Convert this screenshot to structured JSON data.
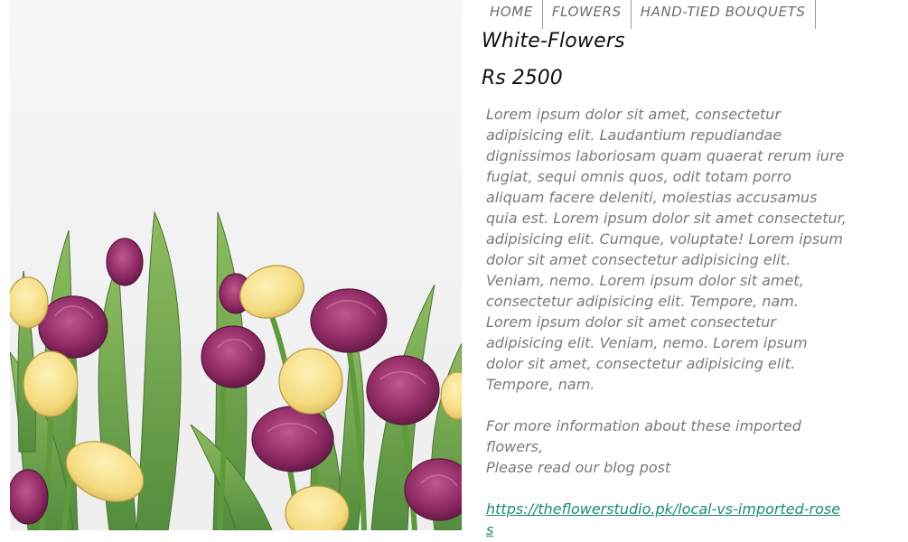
{
  "nav": {
    "items": [
      {
        "label": "HOME"
      },
      {
        "label": "FLOWERS"
      },
      {
        "label": "HAND-TIED BOUQUETS"
      }
    ]
  },
  "product": {
    "title": "White-Flowers",
    "price": "Rs 2500",
    "description": "Lorem ipsum dolor sit amet, consectetur adipisicing elit. Laudantium repudiandae dignissimos laboriosam quam quaerat rerum iure fugiat, sequi omnis quos, odit totam porro aliquam facere deleniti, molestias accusamus quia est. Lorem ipsum dolor sit amet consectetur, adipisicing elit. Cumque, voluptate! Lorem ipsum dolor sit amet consectetur adipisicing elit. Veniam, nemo. Lorem ipsum dolor sit amet, consectetur adipisicing elit. Tempore, nam. Lorem ipsum dolor sit amet consectetur adipisicing elit. Veniam, nemo. Lorem ipsum dolor sit amet, consectetur adipisicing elit. Tempore, nam.",
    "more_info_line1": "For more information about these imported flowers,",
    "more_info_line2": "Please read our blog post",
    "blog_link": "https://theflowerstudio.pk/local-vs-imported-roses"
  },
  "colors": {
    "link": "#1a8a76",
    "body_text": "#7a7a7a",
    "heading_text": "#111111",
    "tulip_purple": "#8e2a63",
    "tulip_yellow": "#f3dd86",
    "leaf_green": "#6fa24a"
  }
}
